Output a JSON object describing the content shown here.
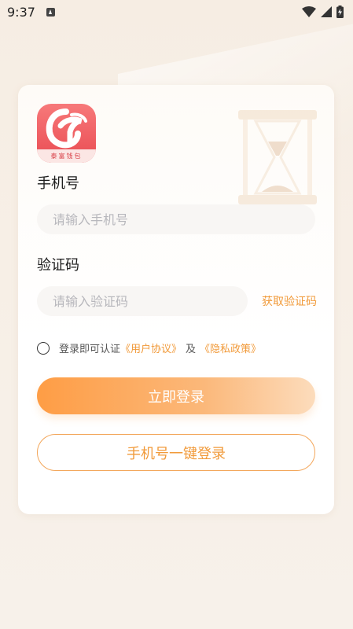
{
  "status_bar": {
    "time": "9:37",
    "icons": [
      "notification-a-icon",
      "wifi-icon",
      "signal-icon",
      "battery-charging-icon"
    ]
  },
  "logo": {
    "caption": "泰富钱包",
    "colors": {
      "primary": "#e94b52",
      "strip": "#fbe6e4"
    }
  },
  "form": {
    "phone_label": "手机号",
    "phone_placeholder": "请输入手机号",
    "code_label": "验证码",
    "code_placeholder": "请输入验证码",
    "get_code_label": "获取验证码"
  },
  "agreement": {
    "prefix": "登录即可认证",
    "user_agreement": "《用户协议》",
    "separator": "及",
    "privacy_policy": "《隐私政策》",
    "checked": false
  },
  "actions": {
    "login_button": "立即登录",
    "one_click_button": "手机号一键登录"
  },
  "colors": {
    "accent": "#f19a3a",
    "button_gradient_start": "#fe9d45",
    "button_gradient_end": "#fcdcbc",
    "background": "#f6ede3"
  }
}
